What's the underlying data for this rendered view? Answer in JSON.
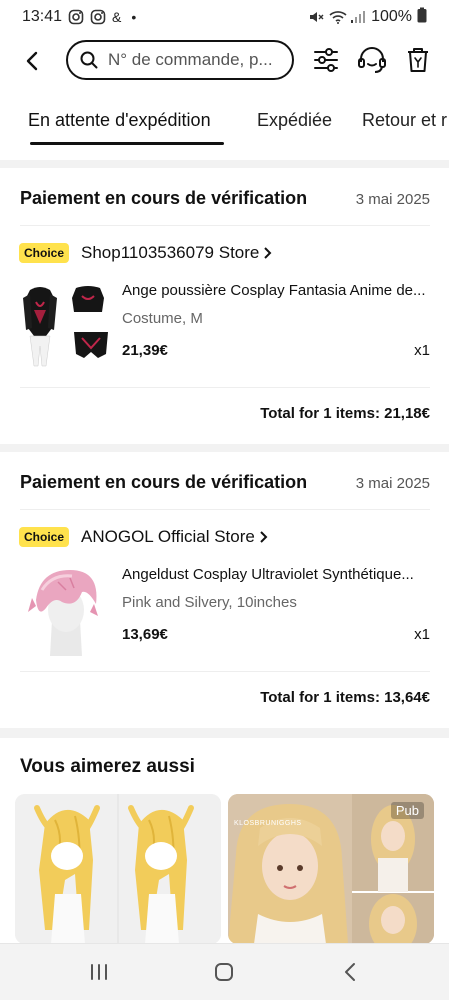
{
  "status_bar": {
    "time": "13:41",
    "extra": "&",
    "dot": "•",
    "battery": "100%",
    "icons": [
      "instagram-icon",
      "instagram-icon",
      "mute-icon",
      "wifi-icon",
      "signal-icon",
      "battery-icon"
    ]
  },
  "header": {
    "back_icon": "chevron-left-icon",
    "search_placeholder": "N° de commande, p...",
    "filter_icon": "sliders-icon",
    "support_icon": "headset-icon",
    "delete_icon": "trash-icon"
  },
  "tabs": [
    {
      "label": "En attente d'expédition",
      "active": true
    },
    {
      "label": "Expédiée",
      "active": false
    },
    {
      "label": "Retour et r",
      "active": false
    }
  ],
  "orders": [
    {
      "status": "Paiement en cours de vérification",
      "date": "3 mai 2025",
      "badge": "Choice",
      "store": "Shop1103536079 Store",
      "item_title": "Ange poussière Cosplay Fantasia Anime de...",
      "variant": "Costume, M",
      "price": "21,39€",
      "qty": "x1",
      "total": "Total for 1 items: 21,18€"
    },
    {
      "status": "Paiement en cours de vérification",
      "date": "3 mai 2025",
      "badge": "Choice",
      "store": "ANOGOL Official Store",
      "item_title": "Angeldust Cosplay Ultraviolet Synthétique...",
      "variant": "Pink and Silvery, 10inches",
      "price": "13,69€",
      "qty": "x1",
      "total": "Total for 1 items: 13,64€"
    }
  ],
  "recommendations": {
    "title": "Vous aimerez aussi",
    "pub_label": "Pub",
    "brand_text": "KLOSBRUNIGGHS"
  },
  "nav": {
    "recents_icon": "recents-icon",
    "home_icon": "home-icon",
    "back_icon": "back-icon"
  },
  "colors": {
    "choice_badge": "#ffe24d",
    "text_primary": "#111111",
    "text_secondary": "#666666",
    "background": "#f2f2f2"
  }
}
